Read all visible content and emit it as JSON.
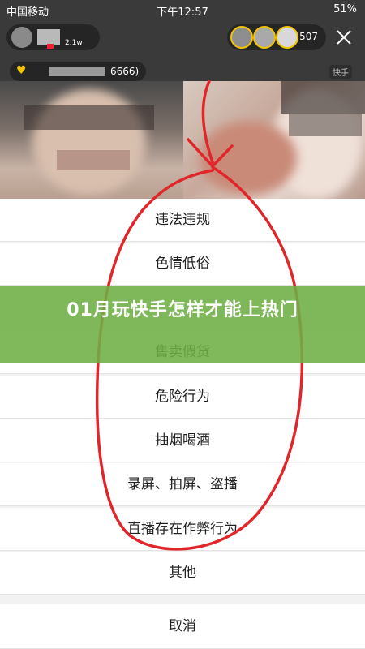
{
  "status_bar": {
    "carrier": "中国移动",
    "time": "下午12:57",
    "battery": "51%"
  },
  "anchor": {
    "sub_text": "2.1w"
  },
  "viewers": {
    "count": "507"
  },
  "user_id": {
    "id_suffix": "6666)"
  },
  "watermark": "快手",
  "report_menu": {
    "options": [
      "违法违规",
      "色情低俗",
      "售卖假货",
      "危险行为",
      "抽烟喝酒",
      "录屏、拍屏、盗播",
      "直播存在作弊行为",
      "其他"
    ],
    "cancel_label": "取消"
  },
  "banner": {
    "title": "01月玩快手怎样才能上热门"
  },
  "colors": {
    "banner_green": "#6eaf46",
    "annotation_red": "#e0262a",
    "viewer_ring": "#f3c400"
  }
}
